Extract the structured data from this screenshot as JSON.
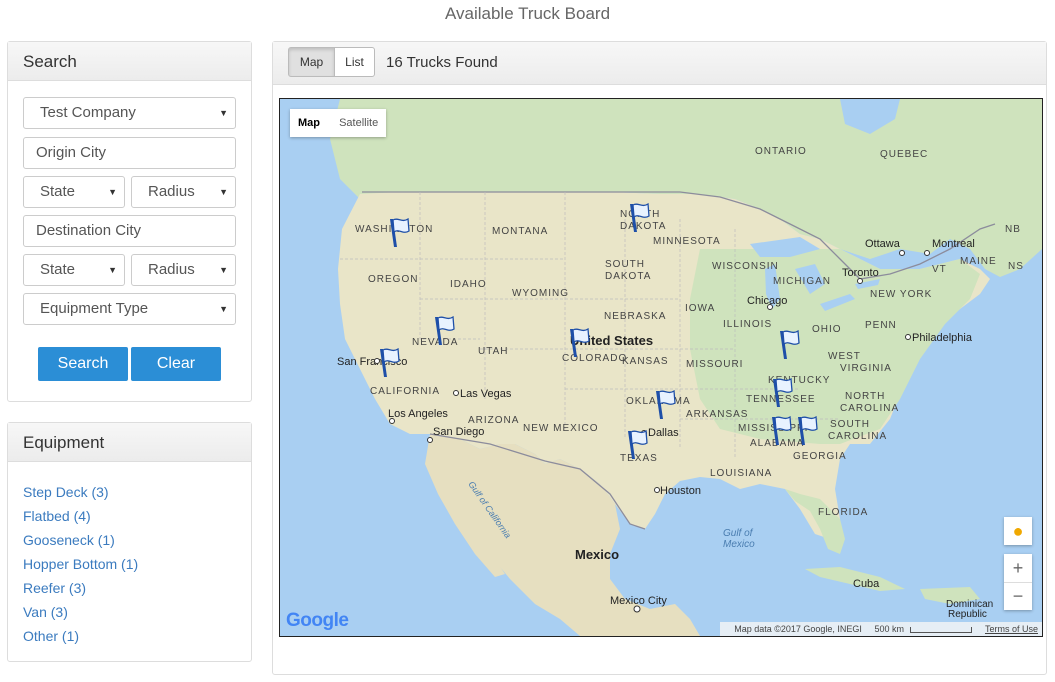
{
  "page": {
    "title": "Available Truck Board"
  },
  "search": {
    "heading": "Search",
    "company": "Test Company",
    "origin_city_placeholder": "Origin City",
    "origin_state": "State",
    "origin_radius": "Radius",
    "destination_city_placeholder": "Destination City",
    "destination_state": "State",
    "destination_radius": "Radius",
    "equipment_type": "Equipment Type",
    "search_label": "Search",
    "clear_label": "Clear"
  },
  "equipment": {
    "heading": "Equipment",
    "items": [
      "Step Deck (3)",
      "Flatbed (4)",
      "Gooseneck (1)",
      "Hopper Bottom (1)",
      "Reefer (3)",
      "Van (3)",
      "Other (1)"
    ]
  },
  "results": {
    "map_tab": "Map",
    "list_tab": "List",
    "count_text": "16 Trucks Found"
  },
  "map": {
    "type_map": "Map",
    "type_satellite": "Satellite",
    "zoom_in": "+",
    "zoom_out": "−",
    "attribution": "Map data ©2017 Google, INEGI",
    "scale": "500 km",
    "terms": "Terms of Use",
    "logo": "Google",
    "labels": {
      "ontario": "ONTARIO",
      "quebec": "QUEBEC",
      "washington": "WASHINGTON",
      "montana": "MONTANA",
      "north_dakota_1": "NORTH",
      "north_dakota_2": "DAKOTA",
      "minnesota": "MINNESOTA",
      "ottawa": "Ottawa",
      "montreal": "Montreal",
      "nb": "NB",
      "vt": "VT",
      "maine": "MAINE",
      "nbs": "NS",
      "oregon": "OREGON",
      "idaho": "IDAHO",
      "south_dakota_1": "SOUTH",
      "south_dakota_2": "DAKOTA",
      "wisconsin": "WISCONSIN",
      "michigan": "MICHIGAN",
      "toronto": "Toronto",
      "new_york": "NEW YORK",
      "wyoming": "WYOMING",
      "chicago": "Chicago",
      "iowa": "IOWA",
      "nebraska": "NEBRASKA",
      "nevada": "NEVADA",
      "illinois": "ILLINOIS",
      "ohio": "OHIO",
      "penn": "PENN",
      "united_states": "United States",
      "utah": "UTAH",
      "colorado": "COLORADO",
      "philadelphia": "Philadelphia",
      "san_francisco": "San Francisco",
      "kansas": "KANSAS",
      "missouri": "MISSOURI",
      "west_virginia_1": "WEST",
      "virginia": "VIRGINIA",
      "kentucky": "KENTUCKY",
      "california": "CALIFORNIA",
      "las_vegas": "Las Vegas",
      "oklahoma": "OKLAHOMA",
      "tennessee": "TENNESSEE",
      "north_carolina_1": "NORTH",
      "north_carolina_2": "CAROLINA",
      "los_angeles": "Los Angeles",
      "arizona": "ARIZONA",
      "arkansas": "ARKANSAS",
      "san_diego": "San Diego",
      "new_mexico": "NEW MEXICO",
      "dallas": "Dallas",
      "mississippi": "MISSISSIPPI",
      "alabama": "ALABAMA",
      "south_carolina_1": "SOUTH",
      "south_carolina_2": "CAROLINA",
      "georgia": "GEORGIA",
      "texas": "TEXAS",
      "louisiana": "LOUISIANA",
      "houston": "Houston",
      "gulf_california": "Gulf of California",
      "florida": "FLORIDA",
      "gulf_mexico_1": "Gulf of",
      "gulf_mexico_2": "Mexico",
      "mexico": "Mexico",
      "cuba": "Cuba",
      "mexico_city": "Mexico City",
      "dominican_1": "Dominican",
      "dominican_2": "Republic"
    }
  }
}
